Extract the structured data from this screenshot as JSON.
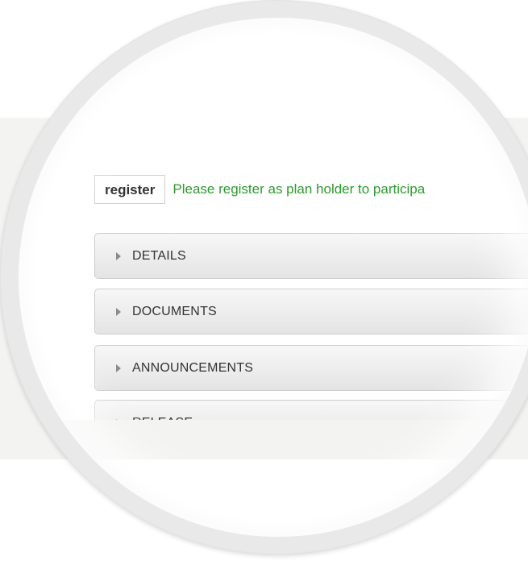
{
  "register": {
    "button_label": "register",
    "message": "Please register as plan holder to participa"
  },
  "accordion": {
    "items": [
      {
        "label": "DETAILS"
      },
      {
        "label": "DOCUMENTS"
      },
      {
        "label": "ANNOUNCEMENTS"
      },
      {
        "label": "RELEASE"
      }
    ]
  },
  "colors": {
    "message_green": "#2e9a2e",
    "backdrop": "#f3f3f1",
    "ring": "#e9e9e9"
  },
  "icons": {
    "accordion_caret": "caret-right-icon"
  }
}
